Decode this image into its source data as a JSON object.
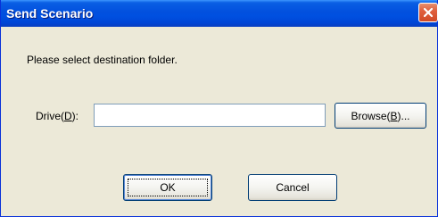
{
  "window": {
    "title": "Send Scenario"
  },
  "dialog": {
    "prompt": "Please select destination folder.",
    "drive": {
      "label_before": "Drive(",
      "label_mnemonic": "D",
      "label_after": "):",
      "value": ""
    },
    "browse": {
      "label_before": "Browse(",
      "label_mnemonic": "B",
      "label_after": ")..."
    },
    "ok_label": "OK",
    "cancel_label": "Cancel"
  },
  "icons": {
    "close": "close-icon"
  },
  "colors": {
    "titlebar": "#0250de",
    "close_button": "#e0603e",
    "dialog_background": "#ece9d8",
    "input_border": "#7f9db9"
  }
}
